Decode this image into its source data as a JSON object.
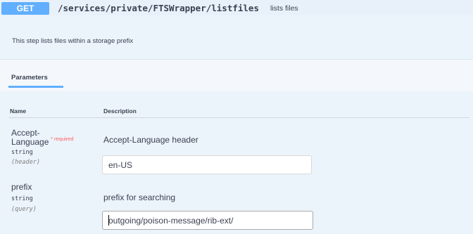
{
  "operation": {
    "method": "GET",
    "path": "/services/private/FTSWrapper/listfiles",
    "summary": "lists files",
    "description": "This step lists files within a storage prefix"
  },
  "parameters_section": {
    "tab_label": "Parameters",
    "column_name": "Name",
    "column_description": "Description"
  },
  "parameters": [
    {
      "name_line1": "Accept-",
      "name_line2": "Language",
      "required_marker": "* required",
      "type": "string",
      "in": "(header)",
      "description": "Accept-Language header",
      "value": "en-US"
    },
    {
      "name": "prefix",
      "type": "string",
      "in": "(query)",
      "description": "prefix for searching",
      "value": "outgoing/poison-message/rib-ext/"
    }
  ],
  "colors": {
    "get_method": "#61affe",
    "required": "#ff6060",
    "block_background": "#ebf3fb"
  }
}
